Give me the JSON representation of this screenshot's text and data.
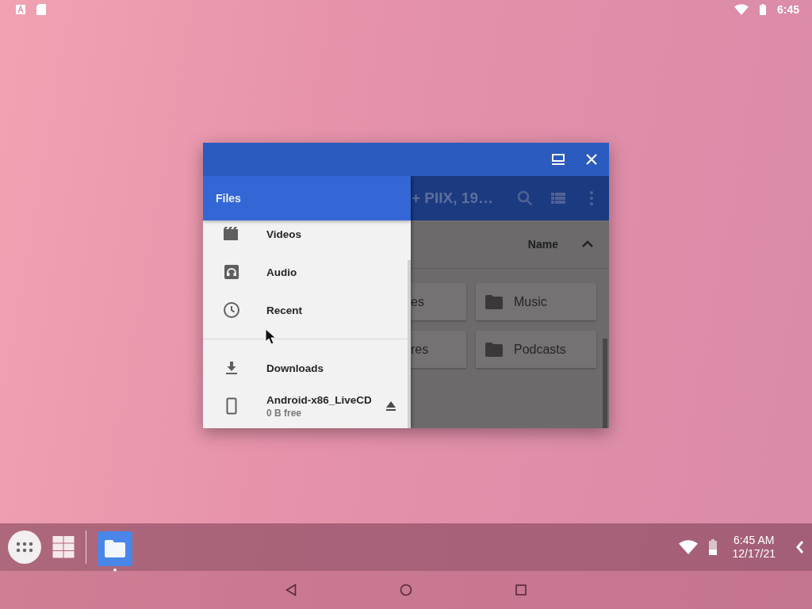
{
  "status_bar": {
    "time": "6:45"
  },
  "window": {
    "app_toolbar": {
      "title": "+ PIIX, 19…"
    },
    "sort": {
      "label": "Name"
    },
    "folders": [
      {
        "name": "es"
      },
      {
        "name": "Music"
      },
      {
        "name": "res"
      },
      {
        "name": "Podcasts"
      }
    ],
    "drawer": {
      "title": "Files",
      "sections": [
        {
          "items": [
            {
              "label": "Videos",
              "kind": "videos"
            },
            {
              "label": "Audio",
              "kind": "audio"
            },
            {
              "label": "Recent",
              "kind": "recent"
            }
          ]
        },
        {
          "items": [
            {
              "label": "Downloads",
              "kind": "downloads"
            },
            {
              "label": "Android-x86_LiveCD",
              "subtitle": "0 B free",
              "kind": "device"
            }
          ]
        }
      ]
    }
  },
  "taskbar": {
    "time": "6:45 AM",
    "date": "12/17/21"
  }
}
